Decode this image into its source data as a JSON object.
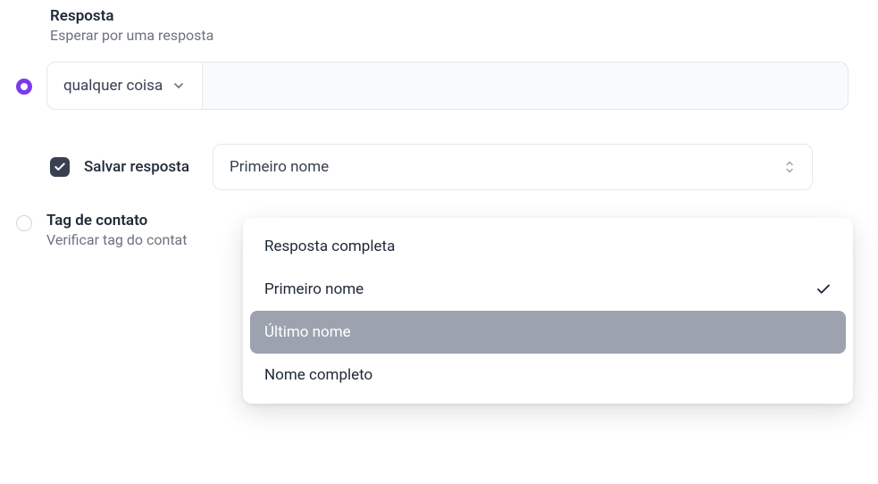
{
  "response": {
    "title": "Resposta",
    "subtitle": "Esperar por uma resposta",
    "match_selector": "qualquer coisa"
  },
  "save": {
    "checkbox_label": "Salvar resposta",
    "select_value": "Primeiro nome"
  },
  "tag": {
    "title": "Tag de contato",
    "subtitle": "Verificar tag do contat"
  },
  "dropdown": {
    "options": [
      {
        "label": "Resposta completa"
      },
      {
        "label": "Primeiro nome"
      },
      {
        "label": "Último nome"
      },
      {
        "label": "Nome completo"
      }
    ],
    "selected_index": 1,
    "highlighted_index": 2
  }
}
